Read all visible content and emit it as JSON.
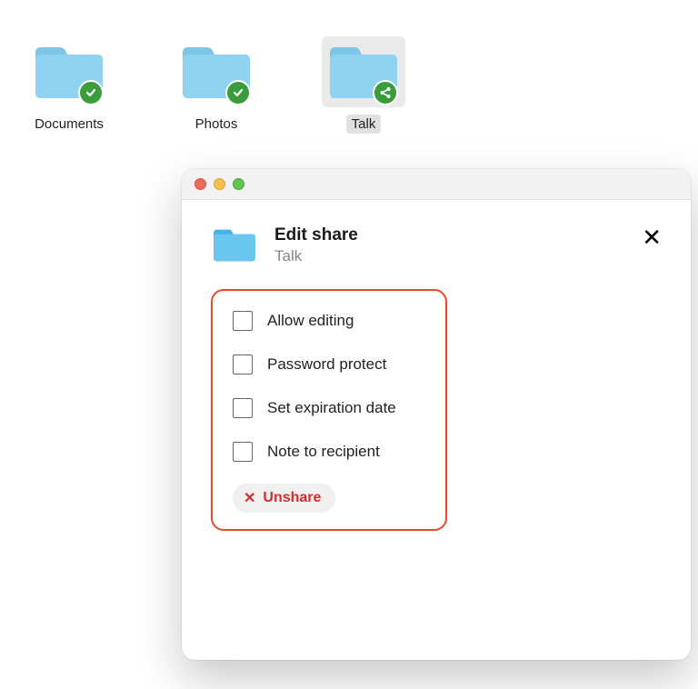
{
  "desktop": {
    "folders": [
      {
        "label": "Documents",
        "badge": "check",
        "selected": false
      },
      {
        "label": "Photos",
        "badge": "check",
        "selected": false
      },
      {
        "label": "Talk",
        "badge": "share",
        "selected": true
      }
    ]
  },
  "dialog": {
    "title": "Edit share",
    "subtitle": "Talk",
    "options": [
      {
        "label": "Allow editing",
        "checked": false
      },
      {
        "label": "Password protect",
        "checked": false
      },
      {
        "label": "Set expiration date",
        "checked": false
      },
      {
        "label": "Note to recipient",
        "checked": false
      }
    ],
    "unshare_label": "Unshare"
  }
}
